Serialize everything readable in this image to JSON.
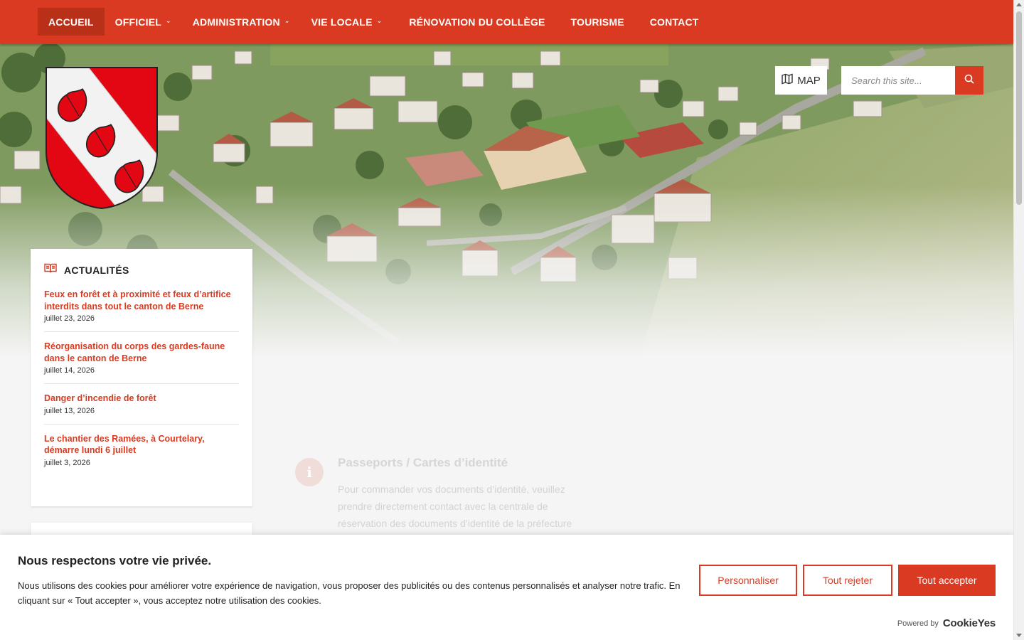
{
  "nav": {
    "items": [
      {
        "label": "ACCUEIL",
        "active": true,
        "has_dropdown": false
      },
      {
        "label": "OFFICIEL",
        "active": false,
        "has_dropdown": true
      },
      {
        "label": "ADMINISTRATION",
        "active": false,
        "has_dropdown": true
      },
      {
        "label": "VIE LOCALE",
        "active": false,
        "has_dropdown": true
      },
      {
        "label": "RÉNOVATION DU COLLÈGE",
        "active": false,
        "has_dropdown": false
      },
      {
        "label": "TOURISME",
        "active": false,
        "has_dropdown": false
      },
      {
        "label": "CONTACT",
        "active": false,
        "has_dropdown": false
      }
    ],
    "dropdown_icon": "chevron-down-icon"
  },
  "header": {
    "map_label": "MAP",
    "map_icon": "map-icon",
    "search_placeholder": "Search this site...",
    "search_icon": "search-icon"
  },
  "news": {
    "title": "ACTUALITÉS",
    "icon": "book-icon",
    "items": [
      {
        "title": "Feux en forêt et à proximité et feux d’artifice interdits dans tout le canton de Berne",
        "date": "juillet 23, 2026"
      },
      {
        "title": "Réorganisation du corps des gardes-faune dans le canton de Berne",
        "date": "juillet 14, 2026"
      },
      {
        "title": "Danger d’incendie de forêt",
        "date": "juillet 13, 2026"
      },
      {
        "title": "Le chantier des Ramées, à Courtelary, démarre lundi 6 juillet",
        "date": "juillet 3, 2026"
      }
    ]
  },
  "background_content": {
    "title": "Passeports / Cartes d’identité",
    "body": "Pour commander vos documents d’identité, veuillez prendre directement contact avec la centrale de réservation des documents d’identité de la préfecture"
  },
  "cookie": {
    "title": "Nous respectons votre vie privée.",
    "text": "Nous utilisons des cookies pour améliorer votre expérience de navigation, vous proposer des publicités ou des contenus personnalisés et analyser notre trafic. En cliquant sur « Tout accepter », vous acceptez notre utilisation des cookies.",
    "customize": "Personnaliser",
    "reject": "Tout rejeter",
    "accept": "Tout accepter",
    "powered_by": "Powered by",
    "brand": "CookieYes"
  },
  "colors": {
    "brand_red": "#d93a21",
    "active_nav": "#b93019",
    "crest_red": "#e30613"
  }
}
